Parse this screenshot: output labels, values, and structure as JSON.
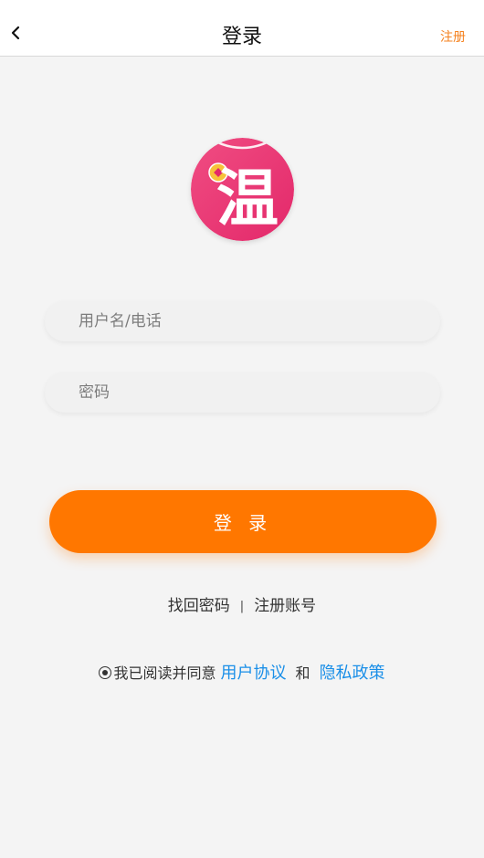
{
  "header": {
    "title": "登录",
    "register_label": "注册"
  },
  "logo": {
    "character": "温"
  },
  "form": {
    "username_placeholder": "用户名/电话",
    "password_placeholder": "密码",
    "login_label": "登 录"
  },
  "links": {
    "forgot_password": "找回密码",
    "separator": "|",
    "register_account": "注册账号"
  },
  "agreement": {
    "prefix": "我已阅读并同意",
    "user_agreement": "用户协议",
    "and": "和",
    "privacy_policy": "隐私政策"
  },
  "colors": {
    "accent": "#ff7700",
    "link_blue": "#1a8fe8",
    "logo_pink": "#e8306f"
  }
}
